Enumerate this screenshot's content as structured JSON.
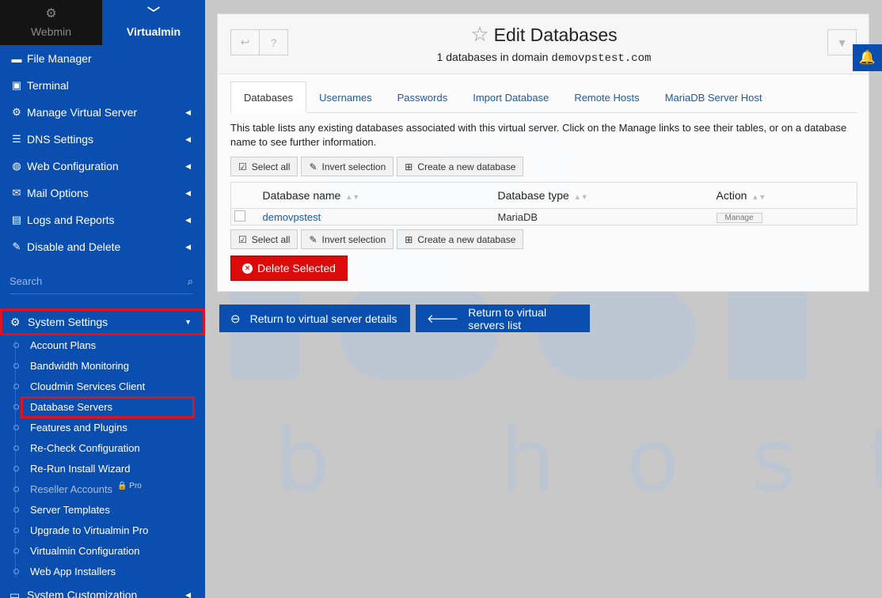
{
  "switcher": {
    "webmin": "Webmin",
    "virtualmin": "Virtualmin"
  },
  "sidebar": {
    "items": [
      {
        "label": "File Manager",
        "icon": "folder-icon"
      },
      {
        "label": "Terminal",
        "icon": "terminal-icon"
      },
      {
        "label": "Manage Virtual Server",
        "icon": "cogs-icon"
      },
      {
        "label": "DNS Settings",
        "icon": "server-icon"
      },
      {
        "label": "Web Configuration",
        "icon": "globe-icon"
      },
      {
        "label": "Mail Options",
        "icon": "envelope-icon"
      },
      {
        "label": "Logs and Reports",
        "icon": "file-text-icon"
      },
      {
        "label": "Disable and Delete",
        "icon": "plug-icon"
      }
    ],
    "search_placeholder": "Search",
    "system_settings": "System Settings",
    "submenu": [
      "Account Plans",
      "Bandwidth Monitoring",
      "Cloudmin Services Client",
      "Database Servers",
      "Features and Plugins",
      "Re-Check Configuration",
      "Re-Run Install Wizard",
      "Reseller Accounts",
      "Server Templates",
      "Upgrade to Virtualmin Pro",
      "Virtualmin Configuration",
      "Web App Installers"
    ],
    "pro_tag": "Pro",
    "system_customization": "System Customization"
  },
  "header": {
    "title": "Edit Databases",
    "subtitle_prefix": "1 databases in domain",
    "domain": "demovpstest.com"
  },
  "tabs": [
    "Databases",
    "Usernames",
    "Passwords",
    "Import Database",
    "Remote Hosts",
    "MariaDB Server Host"
  ],
  "description": "This table lists any existing databases associated with this virtual server. Click on the Manage links to see their tables, or on a database name to see further information.",
  "actions": {
    "select_all": "Select all",
    "invert": "Invert selection",
    "create": "Create a new database"
  },
  "table": {
    "headers": [
      "Database name",
      "Database type",
      "Action"
    ],
    "rows": [
      {
        "name": "demovpstest",
        "type": "MariaDB",
        "action": "Manage"
      }
    ]
  },
  "delete_selected": "Delete Selected",
  "return_details": "Return to virtual server details",
  "return_list": "Return to virtual servers list",
  "colors": {
    "sidebar": "#0a4fb0",
    "highlight": "#e3111d",
    "danger": "#dc0b0b",
    "link": "#1a5aa8"
  }
}
